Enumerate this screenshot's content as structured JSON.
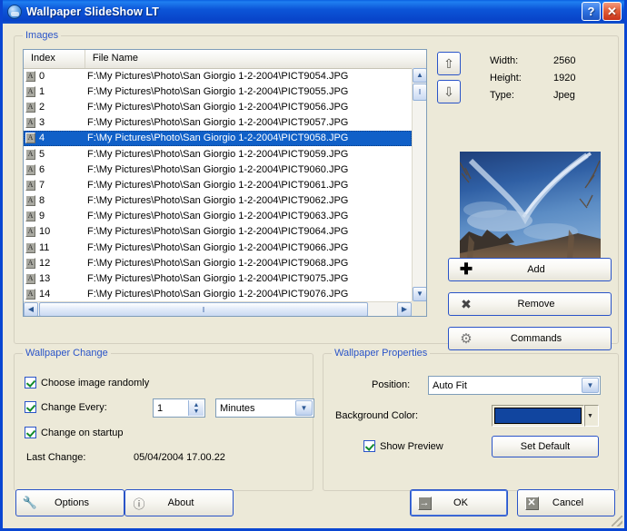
{
  "window": {
    "title": "Wallpaper SlideShow LT",
    "icon": "app-globe-icon",
    "help_label": "?",
    "close_label": "✕"
  },
  "images_group": {
    "legend": "Images",
    "columns": [
      "Index",
      "File Name"
    ],
    "rows": [
      {
        "index": "0",
        "file": "F:\\My Pictures\\Photo\\San Giorgio 1-2-2004\\PICT9054.JPG",
        "selected": false
      },
      {
        "index": "1",
        "file": "F:\\My Pictures\\Photo\\San Giorgio 1-2-2004\\PICT9055.JPG",
        "selected": false
      },
      {
        "index": "2",
        "file": "F:\\My Pictures\\Photo\\San Giorgio 1-2-2004\\PICT9056.JPG",
        "selected": false
      },
      {
        "index": "3",
        "file": "F:\\My Pictures\\Photo\\San Giorgio 1-2-2004\\PICT9057.JPG",
        "selected": false
      },
      {
        "index": "4",
        "file": "F:\\My Pictures\\Photo\\San Giorgio 1-2-2004\\PICT9058.JPG",
        "selected": true
      },
      {
        "index": "5",
        "file": "F:\\My Pictures\\Photo\\San Giorgio 1-2-2004\\PICT9059.JPG",
        "selected": false
      },
      {
        "index": "6",
        "file": "F:\\My Pictures\\Photo\\San Giorgio 1-2-2004\\PICT9060.JPG",
        "selected": false
      },
      {
        "index": "7",
        "file": "F:\\My Pictures\\Photo\\San Giorgio 1-2-2004\\PICT9061.JPG",
        "selected": false
      },
      {
        "index": "8",
        "file": "F:\\My Pictures\\Photo\\San Giorgio 1-2-2004\\PICT9062.JPG",
        "selected": false
      },
      {
        "index": "9",
        "file": "F:\\My Pictures\\Photo\\San Giorgio 1-2-2004\\PICT9063.JPG",
        "selected": false
      },
      {
        "index": "10",
        "file": "F:\\My Pictures\\Photo\\San Giorgio 1-2-2004\\PICT9064.JPG",
        "selected": false
      },
      {
        "index": "11",
        "file": "F:\\My Pictures\\Photo\\San Giorgio 1-2-2004\\PICT9066.JPG",
        "selected": false
      },
      {
        "index": "12",
        "file": "F:\\My Pictures\\Photo\\San Giorgio 1-2-2004\\PICT9068.JPG",
        "selected": false
      },
      {
        "index": "13",
        "file": "F:\\My Pictures\\Photo\\San Giorgio 1-2-2004\\PICT9075.JPG",
        "selected": false
      },
      {
        "index": "14",
        "file": "F:\\My Pictures\\Photo\\San Giorgio 1-2-2004\\PICT9076.JPG",
        "selected": false
      }
    ],
    "row_icon": "text-document-icon",
    "row_icon_glyph": "A",
    "move_up_glyph": "⇧",
    "move_down_glyph": "⇩",
    "properties": [
      {
        "label": "Width:",
        "value": "2560"
      },
      {
        "label": "Height:",
        "value": "1920"
      },
      {
        "label": "Type:",
        "value": "Jpeg"
      }
    ],
    "buttons": [
      {
        "label": "Add",
        "icon": "plus-icon",
        "glyph": "✚"
      },
      {
        "label": "Remove",
        "icon": "cross-icon",
        "glyph": "✖"
      },
      {
        "label": "Commands",
        "icon": "gear-icon",
        "glyph": "⚙"
      }
    ],
    "scrollbar": {
      "up_glyph": "▲",
      "down_glyph": "▼",
      "left_glyph": "◀",
      "right_glyph": "▶",
      "grip_glyph": "‖"
    }
  },
  "wallpaper_change": {
    "legend": "Wallpaper Change",
    "choose_random_label": "Choose image randomly",
    "choose_random_checked": true,
    "change_every_label": "Change Every:",
    "change_every_checked": true,
    "interval_value": "1",
    "interval_unit": "Minutes",
    "change_on_startup_label": "Change on startup",
    "change_on_startup_checked": true,
    "last_change_label": "Last Change:",
    "last_change_value": "05/04/2004 17.00.22"
  },
  "wallpaper_properties": {
    "legend": "Wallpaper Properties",
    "position_label": "Position:",
    "position_value": "Auto Fit",
    "background_color_label": "Background Color:",
    "background_color_value": "#11459f",
    "show_preview_label": "Show Preview",
    "show_preview_checked": true,
    "set_default_label": "Set Default"
  },
  "footer": {
    "options_label": "Options",
    "options_icon": "wrench-icon",
    "about_label": "About",
    "about_icon": "info-icon",
    "ok_label": "OK",
    "ok_icon": "arrow-right-icon",
    "cancel_label": "Cancel",
    "cancel_icon": "x-icon"
  },
  "colors": {
    "titlebar_blue": "#0c55d8",
    "frame_blue": "#0a46d2",
    "dialog_face": "#ece9d8",
    "group_legend": "#2a54c8",
    "selection": "#1060c8"
  }
}
